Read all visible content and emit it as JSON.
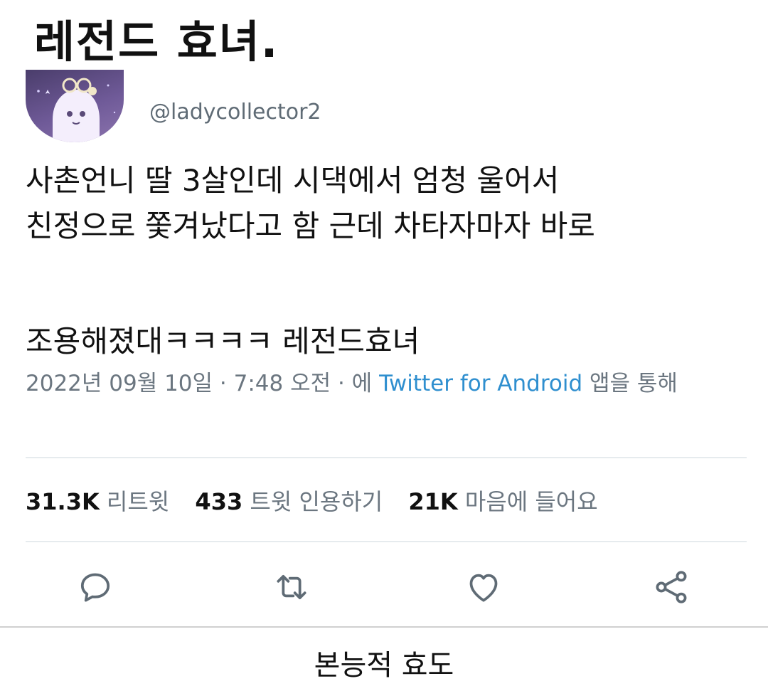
{
  "page_title": "레전드 효녀.",
  "tweet": {
    "avatar_icon": "ghost-avatar-icon",
    "handle": "@ladycollector2",
    "lines": [
      "사촌언니 딸 3살인데 시댁에서 엄청 울어서",
      "친정으로 쫓겨났다고 함 근데 차타자마자 바로",
      "조용해졌대ㅋㅋㅋㅋ 레전드효녀"
    ],
    "meta": {
      "datetime": "2022년 09월 10일 · 7:48 오전 · 에 ",
      "source": "Twitter for Android",
      "suffix": " 앱을 통해"
    },
    "stats": [
      {
        "value": "31.3K",
        "label": "리트윗"
      },
      {
        "value": "433",
        "label": "트윗 인용하기"
      },
      {
        "value": "21K",
        "label": "마음에 들어요"
      }
    ],
    "actions": [
      "reply-icon",
      "retweet-icon",
      "like-icon",
      "share-icon"
    ]
  },
  "caption": "본능적 효도",
  "colors": {
    "link": "#2f8fcf",
    "muted": "#6b7680",
    "icon": "#5f6b75"
  }
}
